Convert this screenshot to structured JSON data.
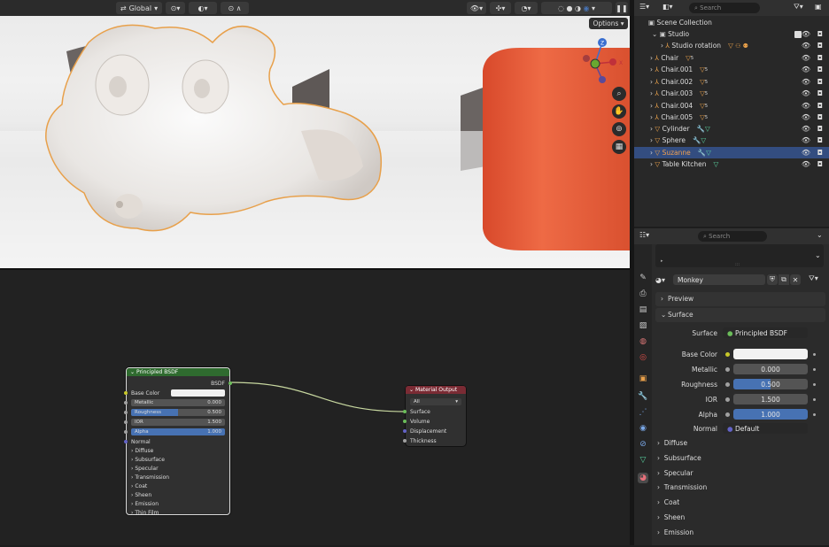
{
  "viewport": {
    "transform": "Global",
    "options": "Options",
    "gizmo_axes": [
      "Z",
      "Y",
      "X"
    ]
  },
  "outliner": {
    "search_placeholder": "Search",
    "root": "Scene Collection",
    "rows": [
      {
        "label": "Studio"
      },
      {
        "label": "Studio rotation"
      },
      {
        "label": "Chair"
      },
      {
        "label": "Chair.001"
      },
      {
        "label": "Chair.002"
      },
      {
        "label": "Chair.003"
      },
      {
        "label": "Chair.004"
      },
      {
        "label": "Chair.005"
      },
      {
        "label": "Cylinder"
      },
      {
        "label": "Sphere"
      },
      {
        "label": "Suzanne"
      },
      {
        "label": "Table Kitchen"
      }
    ],
    "modifier_count": "5"
  },
  "properties": {
    "search_placeholder": "Search",
    "material_name": "Monkey",
    "panel_preview": "Preview",
    "panel_surface": "Surface",
    "surface_label": "Surface",
    "surface_value": "Principled BSDF",
    "fields": [
      {
        "label": "Base Color",
        "value": ""
      },
      {
        "label": "Metallic",
        "value": "0.000"
      },
      {
        "label": "Roughness",
        "value": "0.500"
      },
      {
        "label": "IOR",
        "value": "1.500"
      },
      {
        "label": "Alpha",
        "value": "1.000"
      },
      {
        "label": "Normal",
        "value": "Default"
      }
    ],
    "subpanels": [
      "Diffuse",
      "Subsurface",
      "Specular",
      "Transmission",
      "Coat",
      "Sheen",
      "Emission"
    ],
    "roughness_fraction": 0.5
  },
  "node_bsdf": {
    "title": "Principled BSDF",
    "output": "BSDF",
    "base_color": "Base Color",
    "fields": [
      {
        "label": "Metallic",
        "value": "0.000"
      },
      {
        "label": "Roughness",
        "value": "0.500"
      },
      {
        "label": "IOR",
        "value": "1.500"
      },
      {
        "label": "Alpha",
        "value": "1.000"
      }
    ],
    "normal": "Normal",
    "subpanels": [
      "Diffuse",
      "Subsurface",
      "Specular",
      "Transmission",
      "Coat",
      "Sheen",
      "Emission",
      "Thin Film"
    ]
  },
  "node_output": {
    "title": "Material Output",
    "target": "All",
    "inputs": [
      "Surface",
      "Volume",
      "Displacement",
      "Thickness"
    ]
  },
  "colors": {
    "selection_orange": "#e8a04a",
    "bsdf_header": "#2f6b2f",
    "output_header": "#7a2b34",
    "active_row": "#334d80",
    "field_blue": "#4772b3",
    "cylinder_orange": "#e85c3a"
  }
}
